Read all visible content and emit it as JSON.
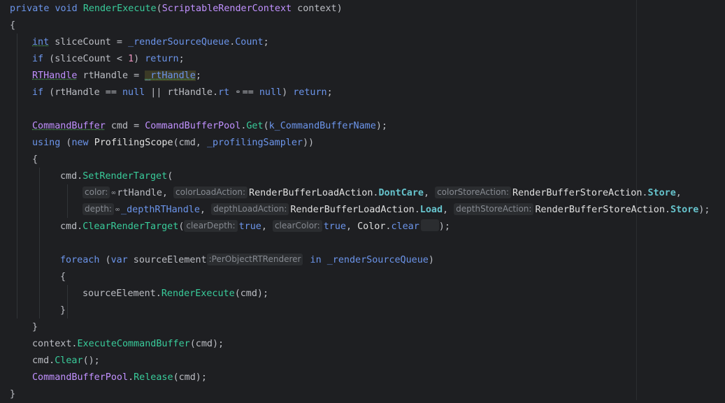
{
  "editor": {
    "lines": [
      "private void RenderExecute(ScriptableRenderContext context)",
      "{",
      "int sliceCount = _renderSourceQueue.Count;",
      "if (sliceCount < 1) return;",
      "RTHandle rtHandle = _rtHandle;",
      "if (rtHandle == null || rtHandle.rt == null) return;",
      "CommandBuffer cmd = CommandBufferPool.Get(k_CommandBufferName);",
      "using (new ProfilingScope(cmd, _profilingSampler))",
      "{",
      "cmd.SetRenderTarget(",
      "rtHandle, RenderBufferLoadAction.DontCare, RenderBufferStoreAction.Store,",
      "_depthRTHandle, RenderBufferLoadAction.Load, RenderBufferStoreAction.Store);",
      "cmd.ClearRenderTarget(true, true, Color.clear);",
      "foreach (var sourceElement in _renderSourceQueue)",
      "{",
      "sourceElement.RenderExecute(cmd);",
      "}",
      "}",
      "context.ExecuteCommandBuffer(cmd);",
      "cmd.Clear();",
      "CommandBufferPool.Release(cmd);",
      "}"
    ],
    "hints": {
      "color": "color:",
      "colorLoadAction": "colorLoadAction:",
      "colorStoreAction": "colorStoreAction:",
      "depth": "depth:",
      "depthLoadAction": "depthLoadAction:",
      "depthStoreAction": "depthStoreAction:",
      "clearDepth": "clearDepth:",
      "clearColor": "clearColor:",
      "varType": ":PerObjectRTRenderer"
    }
  }
}
